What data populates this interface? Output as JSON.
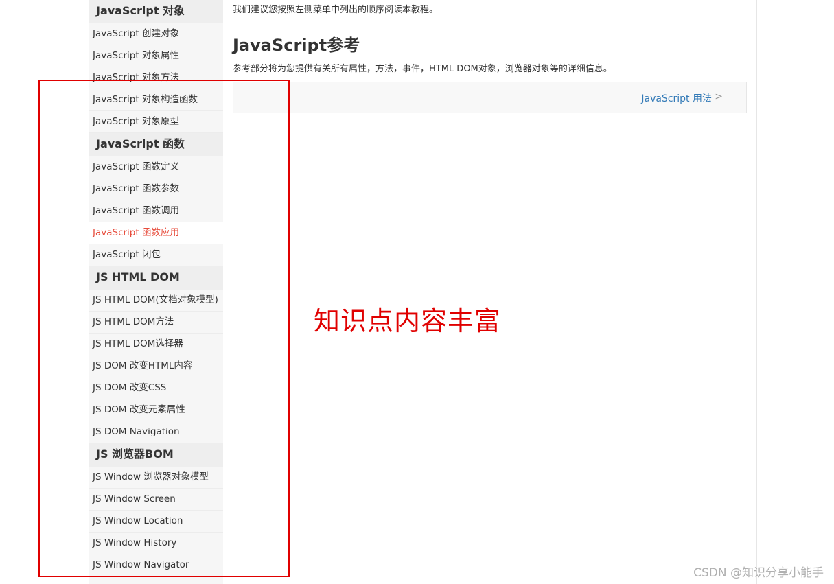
{
  "sidebar": {
    "sections": [
      {
        "heading": "JavaScript 对象",
        "items": [
          {
            "label": "JavaScript 创建对象"
          },
          {
            "label": "JavaScript 对象属性"
          },
          {
            "label": "JavaScript 对象方法"
          },
          {
            "label": "JavaScript 对象构造函数"
          },
          {
            "label": "JavaScript 对象原型"
          }
        ]
      },
      {
        "heading": "JavaScript 函数",
        "items": [
          {
            "label": "JavaScript 函数定义"
          },
          {
            "label": "JavaScript 函数参数"
          },
          {
            "label": "JavaScript 函数调用"
          },
          {
            "label": "JavaScript 函数应用",
            "active": true
          },
          {
            "label": "JavaScript 闭包"
          }
        ]
      },
      {
        "heading": "JS HTML DOM",
        "items": [
          {
            "label": "JS HTML DOM(文档对象模型)"
          },
          {
            "label": "JS HTML DOM方法"
          },
          {
            "label": "JS HTML DOM选择器"
          },
          {
            "label": "JS DOM 改变HTML内容"
          },
          {
            "label": "JS DOM 改变CSS"
          },
          {
            "label": "JS DOM 改变元素属性"
          },
          {
            "label": "JS DOM Navigation"
          }
        ]
      },
      {
        "heading": "JS 浏览器BOM",
        "items": [
          {
            "label": "JS Window 浏览器对象模型"
          },
          {
            "label": "JS Window Screen"
          },
          {
            "label": "JS Window Location"
          },
          {
            "label": "JS Window History"
          },
          {
            "label": "JS Window Navigator"
          }
        ]
      }
    ]
  },
  "main": {
    "intro": "我们建议您按照左侧菜单中列出的顺序阅读本教程。",
    "ref_title": "JavaScript参考",
    "ref_desc": "参考部分将为您提供有关所有属性，方法，事件，HTML DOM对象，浏览器对象等的详细信息。",
    "next_label": "JavaScript 用法",
    "next_arrow": ">"
  },
  "annotation": {
    "text": "知识点内容丰富",
    "color": "#e00000"
  },
  "watermark": "CSDN @知识分享小能手",
  "colors": {
    "active_item": "#e74c3c",
    "link": "#337ab7"
  }
}
